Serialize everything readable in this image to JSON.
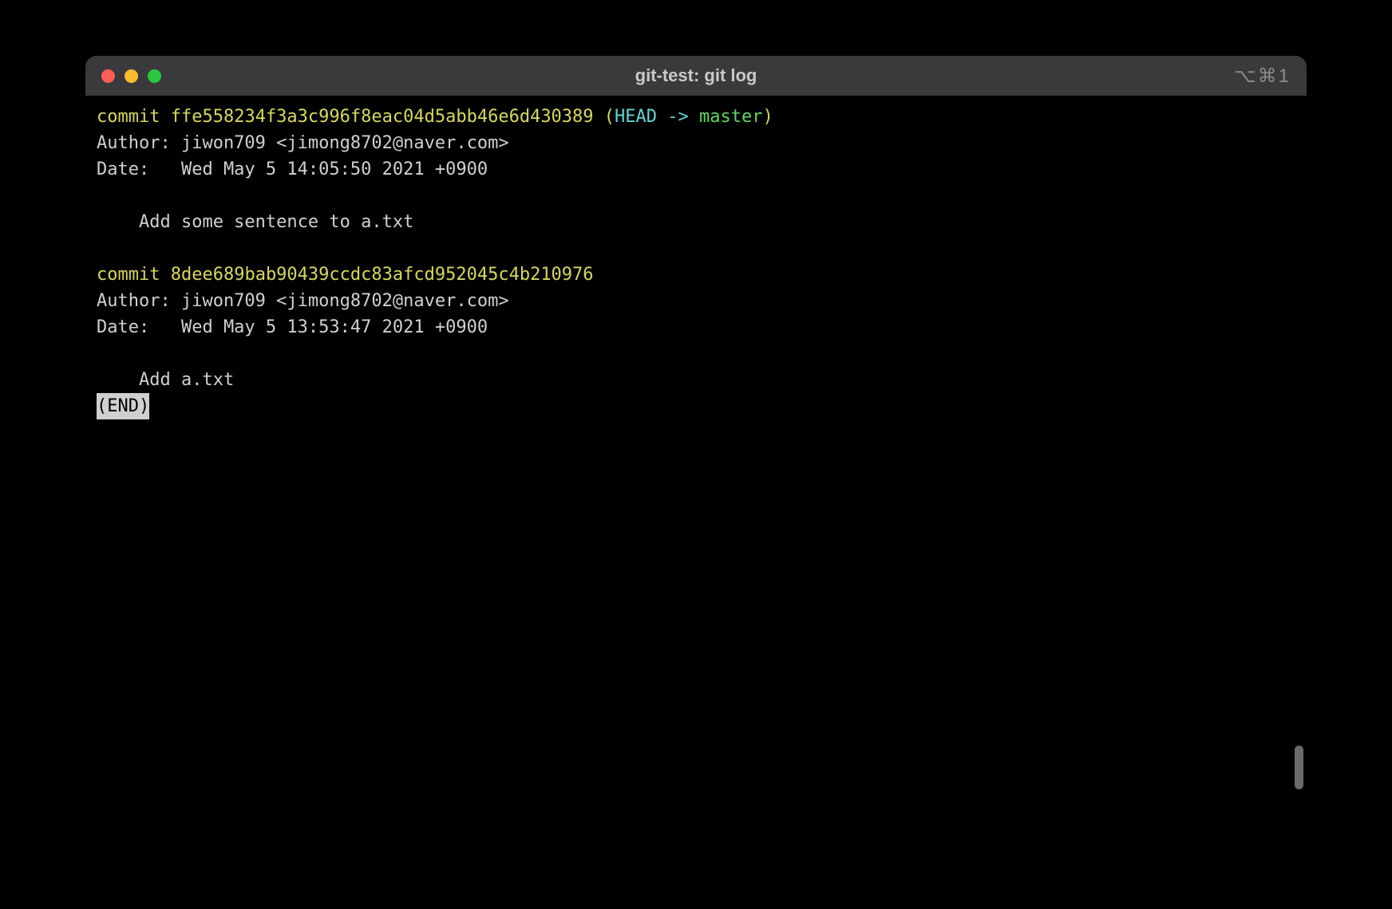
{
  "window": {
    "title": "git-test: git log",
    "right_indicator": "⌥⌘1"
  },
  "commits": [
    {
      "commit_word": "commit",
      "hash": "ffe558234f3a3c996f8eac04d5abb46e6d430389",
      "ref_open": " (",
      "head": "HEAD -> ",
      "branch": "master",
      "ref_close": ")",
      "author_line": "Author: jiwon709 <jimong8702@naver.com>",
      "date_line": "Date:   Wed May 5 14:05:50 2021 +0900",
      "message": "    Add some sentence to a.txt"
    },
    {
      "commit_word": "commit",
      "hash": "8dee689bab90439ccdc83afcd952045c4b210976",
      "author_line": "Author: jiwon709 <jimong8702@naver.com>",
      "date_line": "Date:   Wed May 5 13:53:47 2021 +0900",
      "message": "    Add a.txt"
    }
  ],
  "pager": {
    "end": "(END)"
  }
}
